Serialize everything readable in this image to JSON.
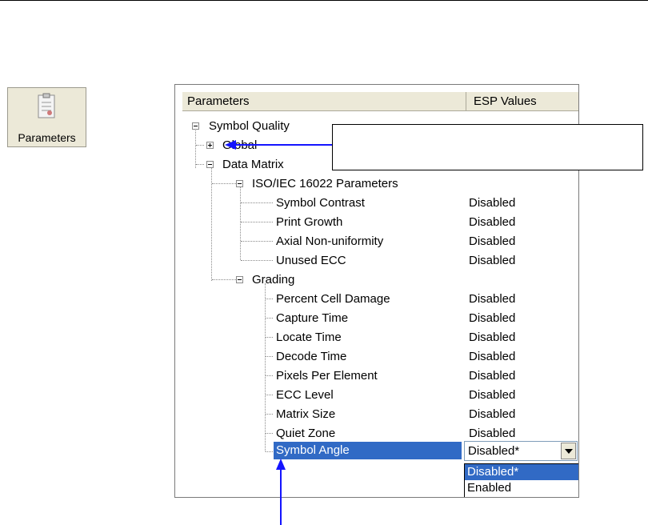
{
  "toolbar": {
    "parameters_label": "Parameters",
    "icon": "parameters-icon"
  },
  "tree": {
    "header": {
      "col_parameters": "Parameters",
      "col_esp_values": "ESP Values"
    },
    "nodes": {
      "symbol_quality": "Symbol Quality",
      "global": "Global",
      "data_matrix": "Data Matrix",
      "iso": "ISO/IEC 16022 Parameters",
      "grading": "Grading"
    },
    "iso_items": [
      {
        "label": "Symbol Contrast",
        "value": "Disabled"
      },
      {
        "label": "Print Growth",
        "value": "Disabled"
      },
      {
        "label": "Axial Non-uniformity",
        "value": "Disabled"
      },
      {
        "label": "Unused ECC",
        "value": "Disabled"
      }
    ],
    "grading_items": [
      {
        "label": "Percent Cell Damage",
        "value": "Disabled"
      },
      {
        "label": "Capture Time",
        "value": "Disabled"
      },
      {
        "label": "Locate Time",
        "value": "Disabled"
      },
      {
        "label": "Decode Time",
        "value": "Disabled"
      },
      {
        "label": "Pixels Per Element",
        "value": "Disabled"
      },
      {
        "label": "ECC Level",
        "value": "Disabled"
      },
      {
        "label": "Matrix Size",
        "value": "Disabled"
      },
      {
        "label": "Quiet Zone",
        "value": "Disabled"
      }
    ],
    "selected": {
      "label": "Symbol Angle",
      "value": "Disabled*"
    },
    "dropdown_options": [
      "Disabled*",
      "Enabled"
    ]
  },
  "colors": {
    "selection": "#316ac5",
    "arrow": "#1414ff",
    "header_bg": "#ece9d8"
  }
}
